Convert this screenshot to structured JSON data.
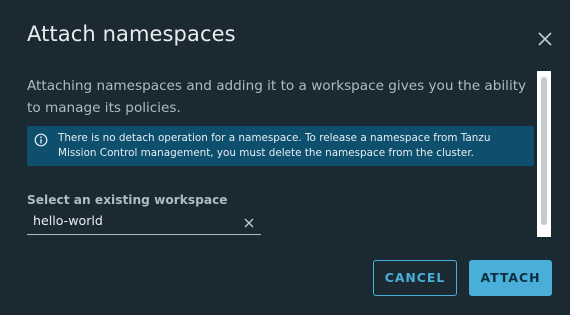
{
  "modal": {
    "title": "Attach namespaces",
    "close_icon": "close-icon"
  },
  "body": {
    "description": "Attaching namespaces and adding it to a workspace gives you the ability to manage its policies.",
    "alert": {
      "icon": "info-circle-icon",
      "text": "There is no detach operation for a namespace. To release a namespace from Tanzu Mission Control management, you must delete the namespace from the cluster."
    },
    "workspace_field": {
      "label": "Select an existing workspace",
      "value": "hello-world",
      "clear_icon": "clear-icon"
    }
  },
  "footer": {
    "cancel_label": "CANCEL",
    "attach_label": "ATTACH"
  },
  "colors": {
    "background": "#1b2a32",
    "accent": "#49afd9",
    "alert_bg": "#0e4f6e"
  }
}
